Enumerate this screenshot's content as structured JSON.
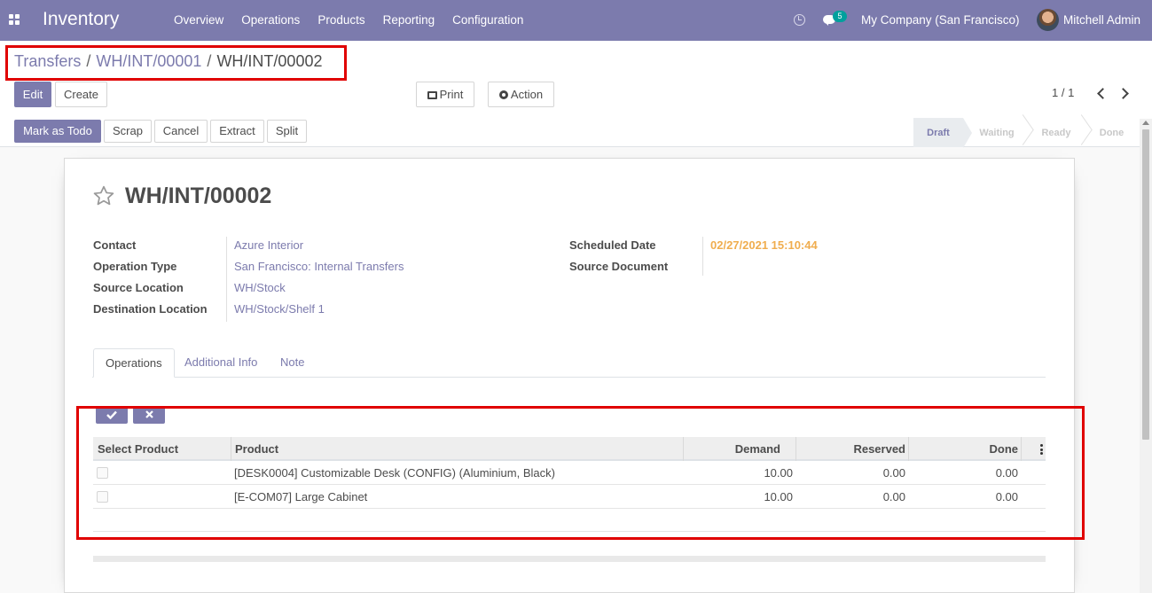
{
  "navbar": {
    "app_name": "Inventory",
    "menu": [
      "Overview",
      "Operations",
      "Products",
      "Reporting",
      "Configuration"
    ],
    "messages_count": "5",
    "company": "My Company (San Francisco)",
    "user": "Mitchell Admin",
    "color": "#7c7bad"
  },
  "breadcrumb": {
    "items": [
      "Transfers",
      "WH/INT/00001"
    ],
    "active": "WH/INT/00002"
  },
  "toolbar": {
    "edit": "Edit",
    "create": "Create",
    "print": "Print",
    "action": "Action",
    "pager": "1 / 1"
  },
  "actions": {
    "mark_todo": "Mark as Todo",
    "scrap": "Scrap",
    "cancel": "Cancel",
    "extract": "Extract",
    "split": "Split"
  },
  "status": {
    "stages": [
      "Draft",
      "Waiting",
      "Ready",
      "Done"
    ],
    "active": "Draft"
  },
  "record": {
    "name": "WH/INT/00002",
    "left_fields": [
      {
        "label": "Contact",
        "value": "Azure Interior"
      },
      {
        "label": "Operation Type",
        "value": "San Francisco: Internal Transfers"
      },
      {
        "label": "Source Location",
        "value": "WH/Stock"
      },
      {
        "label": "Destination Location",
        "value": "WH/Stock/Shelf 1"
      }
    ],
    "right_fields": [
      {
        "label": "Scheduled Date",
        "value": "02/27/2021 15:10:44"
      },
      {
        "label": "Source Document",
        "value": ""
      }
    ]
  },
  "tabs": [
    "Operations",
    "Additional Info",
    "Note"
  ],
  "active_tab": "Operations",
  "table": {
    "columns": [
      "Select Product",
      "Product",
      "Demand",
      "Reserved",
      "Done"
    ],
    "rows": [
      {
        "product": "[DESK0004] Customizable Desk (CONFIG) (Aluminium, Black)",
        "demand": "10.00",
        "reserved": "0.00",
        "done": "0.00"
      },
      {
        "product": "[E-COM07] Large Cabinet",
        "demand": "10.00",
        "reserved": "0.00",
        "done": "0.00"
      }
    ]
  },
  "icons": {
    "apps": "apps-grid-icon",
    "activity": "clock-icon",
    "messages": "chat-icon",
    "favorite": "star-icon",
    "print": "printer-icon",
    "action": "gear-icon",
    "confirm": "check-icon",
    "discard": "close-icon",
    "optional_columns": "kebab-icon"
  }
}
